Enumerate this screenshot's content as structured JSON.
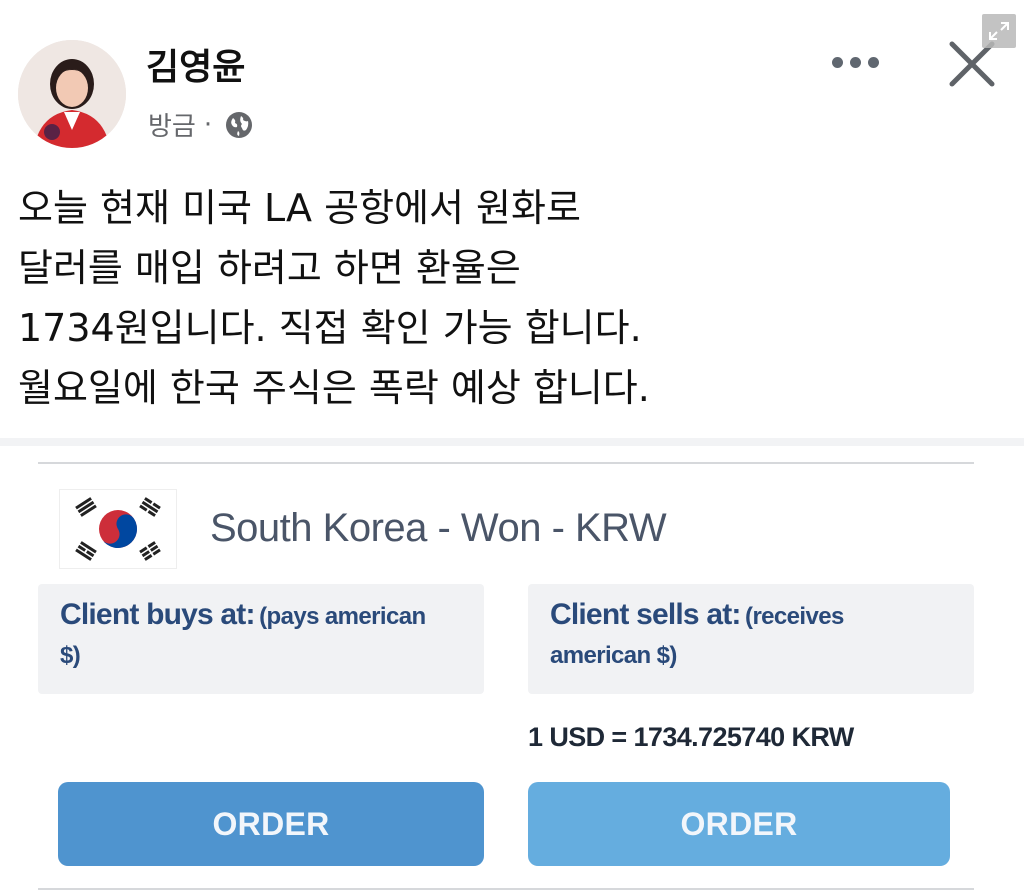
{
  "post": {
    "author": "김영윤",
    "timestamp": "방금",
    "separator": "·",
    "privacy_icon": "globe-icon",
    "text_lines": [
      "오늘 현재 미국 LA 공항에서 원화로",
      "달러를 매입 하려고 하면 환율은",
      "1734원입니다. 직접 확인 가능 합니다.",
      "월요일에 한국 주식은 폭락 예상 합니다."
    ]
  },
  "header_actions": {
    "more_icon": "more-options-icon",
    "close_icon": "close-icon",
    "expand_icon": "expand-icon"
  },
  "currency_card": {
    "flag_icon": "south-korea-flag-icon",
    "currency_name": "South Korea - Won - KRW",
    "buy": {
      "label": "Client buys at:",
      "note_part1": "(pays american",
      "note_part2": "$)",
      "button": "ORDER"
    },
    "sell": {
      "label": "Client sells at:",
      "note_part1": "(receives",
      "note_part2": "american $)",
      "button": "ORDER"
    },
    "rate": "1 USD = 1734.725740 KRW"
  },
  "colors": {
    "buy_button": "#4f94cf",
    "sell_button": "#65addf",
    "label_text": "#2a4a7a",
    "box_bg": "#f1f2f4"
  }
}
